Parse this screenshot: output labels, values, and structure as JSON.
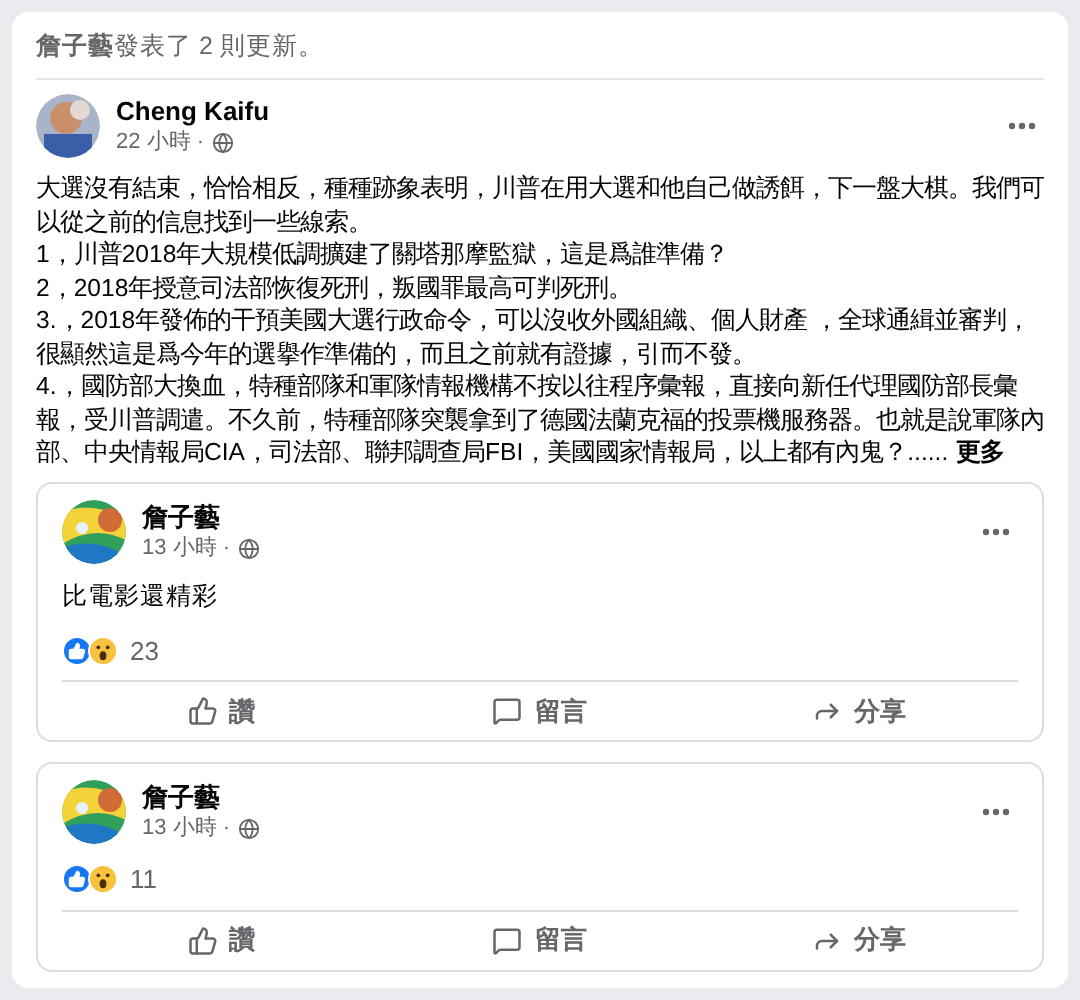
{
  "header": "**詹子藝**發表了 2 則更新。",
  "main_post": {
    "author": "Cheng Kaifu",
    "time": "22 小時 ·",
    "paragraphs": [
      "大選沒有結束，恰恰相反，種種跡象表明，川普在用大選和他自己做誘餌，下一盤大棋。我們可以從之前的信息找到一些線索。",
      "1，川普2018年大規模低調擴建了關塔那摩監獄，這是爲誰準備？",
      "2，2018年授意司法部恢復死刑，叛國罪最高可判死刑。",
      "3.，2018年發佈的干預美國大選行政命令，可以沒收外國組織、個人財產 ，全球通緝並審判，很顯然這是爲今年的選擧作準備的，而且之前就有證據，引而不發。",
      "4.，國防部大換血，特種部隊和軍隊情報機構不按以往程序彙報，直接向新任代理國防部長彙報，受川普調遣。不久前，特種部隊突襲拿到了德國法蘭克福的投票機服務器。也就是說軍隊內部、中央情報局CIA，司法部、聯邦調查局FBI，美國國家情報局，以上都有內鬼？......"
    ],
    "more": "更多"
  },
  "updates": [
    {
      "author": "詹子藝",
      "time": "13 小時 ·",
      "text": "比電影還精彩",
      "reactions": "23",
      "actions": [
        "讚",
        "留言",
        "分享"
      ]
    },
    {
      "author": "詹子藝",
      "time": "13 小時 ·",
      "reactions": "11",
      "actions": [
        "讚",
        "留言",
        "分享"
      ]
    }
  ]
}
